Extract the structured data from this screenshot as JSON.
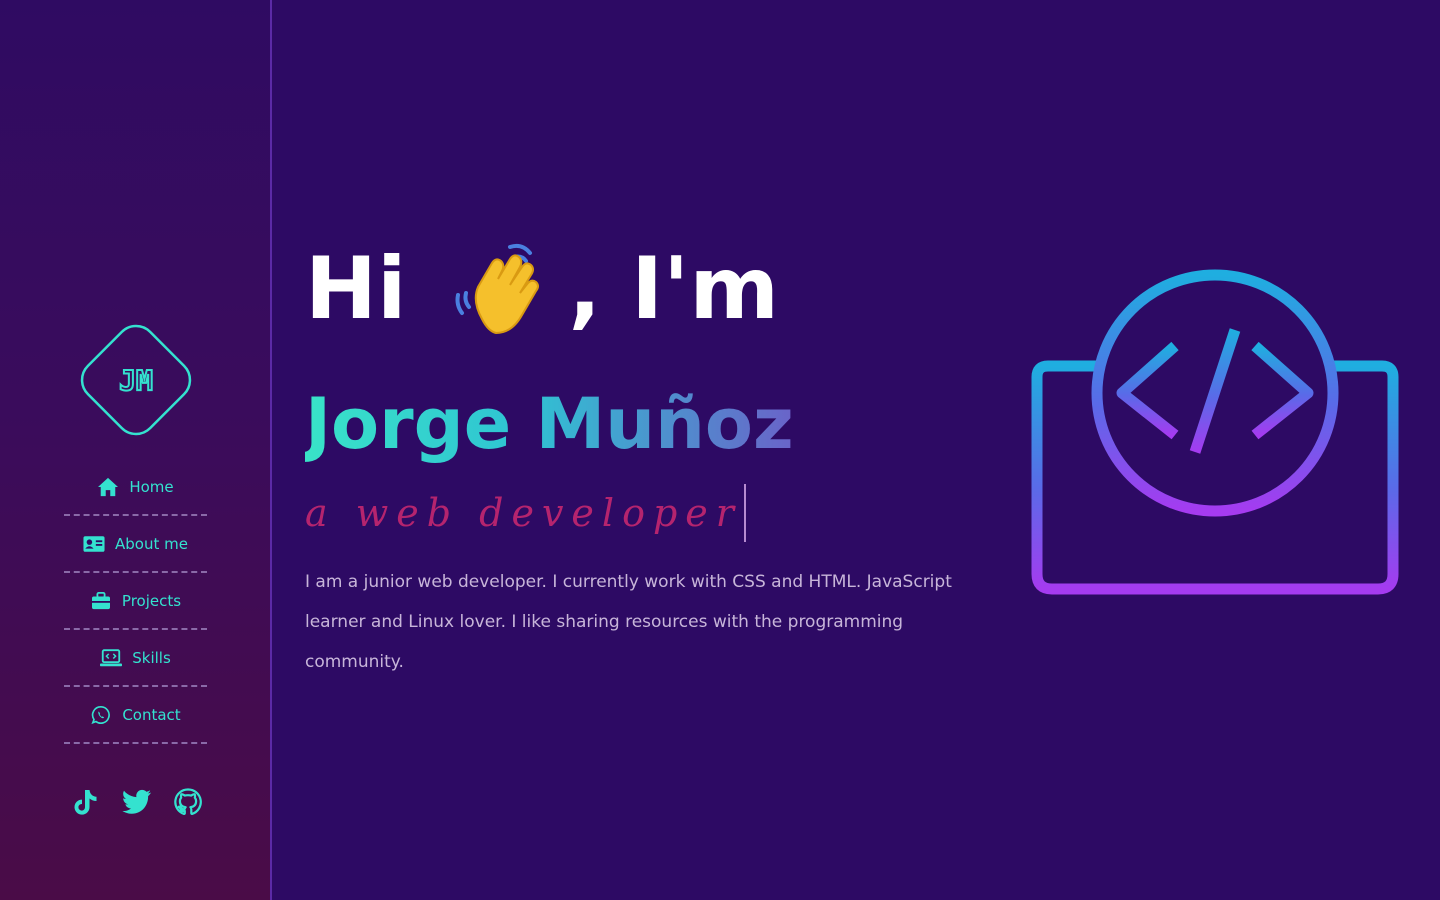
{
  "brand": {
    "logo_text": "JM"
  },
  "nav": {
    "items": [
      {
        "label": "Home",
        "icon": "home-icon"
      },
      {
        "label": "About me",
        "icon": "id-card-icon"
      },
      {
        "label": "Projects",
        "icon": "briefcase-icon"
      },
      {
        "label": "Skills",
        "icon": "code-laptop-icon"
      },
      {
        "label": "Contact",
        "icon": "whatsapp-icon"
      }
    ]
  },
  "social": {
    "links": [
      {
        "icon": "tiktok-icon"
      },
      {
        "icon": "twitter-icon"
      },
      {
        "icon": "github-icon"
      }
    ]
  },
  "hero": {
    "greeting_start": "Hi",
    "greeting_end": ", I'm",
    "wave_icon": "waving-hand-icon",
    "name": "Jorge Muñoz",
    "role": "a web developer",
    "bio": "I am a junior web developer. I currently work with CSS and HTML. JavaScript learner and Linux lover. I like sharing resources with the programming community.",
    "illustration": "code-monitor-icon"
  },
  "colors": {
    "background": "#2d0a64",
    "accent_teal": "#34e2cf",
    "role_pink": "#b5246e",
    "text_muted": "#c7b5d9",
    "illustration_blue": "#2a9be0",
    "illustration_purple": "#a53bf0"
  }
}
